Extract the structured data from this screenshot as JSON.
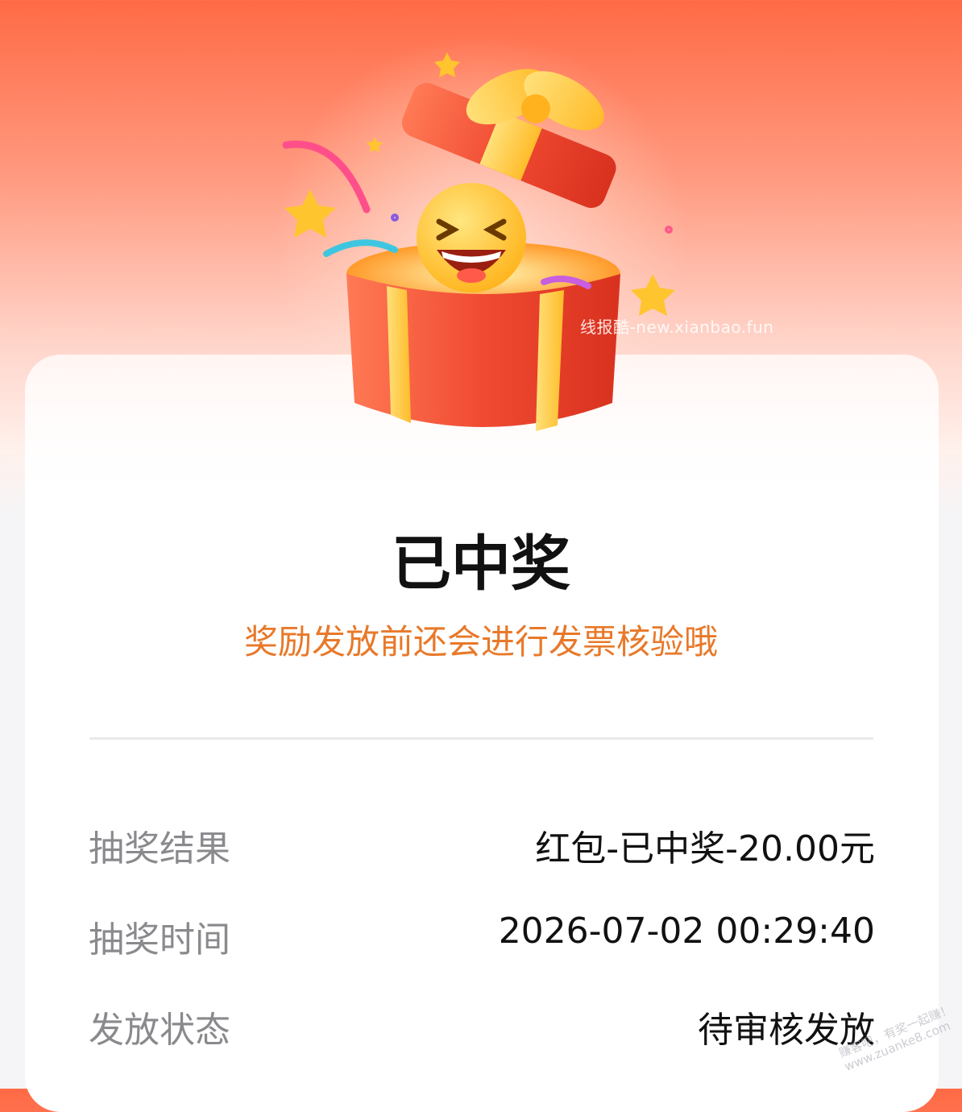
{
  "header": {
    "watermark": "线报酷-new.xianbao.fun"
  },
  "result": {
    "title": "已中奖",
    "subtitle": "奖励发放前还会进行发票核验哦"
  },
  "details": [
    {
      "label": "抽奖结果",
      "value": "红包-已中奖-20.00元"
    },
    {
      "label": "抽奖时间",
      "value": "2026-07-02 00:29:40"
    },
    {
      "label": "发放状态",
      "value": "待审核发放"
    }
  ],
  "footer_watermark": {
    "line1": "赚客吧，有奖一起赚！",
    "line2": "www.zuanke8.com"
  },
  "colors": {
    "brand_top": "#ff6a45",
    "subtitle": "#e8792a",
    "gift_red": "#f0442e",
    "gift_gold": "#ffc634"
  },
  "icons": [
    "gift-box-icon",
    "laughing-emoji-icon",
    "star-icon",
    "confetti-icon"
  ]
}
